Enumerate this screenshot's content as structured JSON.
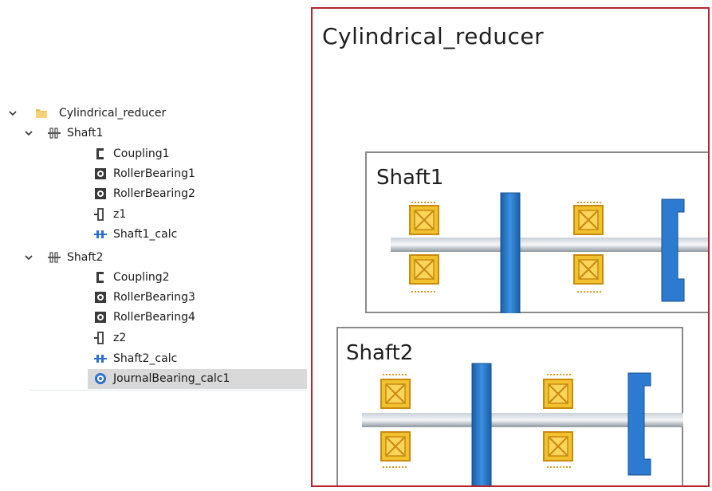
{
  "tree": {
    "root": {
      "label": "Cylindrical_reducer",
      "icon": "folder-icon"
    },
    "shaft1": {
      "label": "Shaft1",
      "icon": "shaft-icon",
      "children": [
        {
          "label": "Coupling1",
          "icon": "coupling-icon"
        },
        {
          "label": "RollerBearing1",
          "icon": "bearing-icon"
        },
        {
          "label": "RollerBearing2",
          "icon": "bearing-icon"
        },
        {
          "label": "z1",
          "icon": "gear-icon"
        },
        {
          "label": "Shaft1_calc",
          "icon": "shaft-calc-icon"
        }
      ]
    },
    "shaft2": {
      "label": "Shaft2",
      "icon": "shaft-icon",
      "children": [
        {
          "label": "Coupling2",
          "icon": "coupling-icon"
        },
        {
          "label": "RollerBearing3",
          "icon": "bearing-icon"
        },
        {
          "label": "RollerBearing4",
          "icon": "bearing-icon"
        },
        {
          "label": "z2",
          "icon": "gear-icon"
        },
        {
          "label": "Shaft2_calc",
          "icon": "shaft-calc-icon"
        },
        {
          "label": "JournalBearing_calc1",
          "icon": "journal-bearing-icon",
          "selected": true
        }
      ]
    }
  },
  "schematic": {
    "title": "Cylindrical_reducer",
    "shaft1_title": "Shaft1",
    "shaft2_title": "Shaft2"
  },
  "colors": {
    "frame": "#b3262d",
    "bearing": "#e8a21a",
    "gear_blue": "#1f6fc0",
    "shaft_grey": "#9aa3ad",
    "selection": "#d9d9d9"
  }
}
